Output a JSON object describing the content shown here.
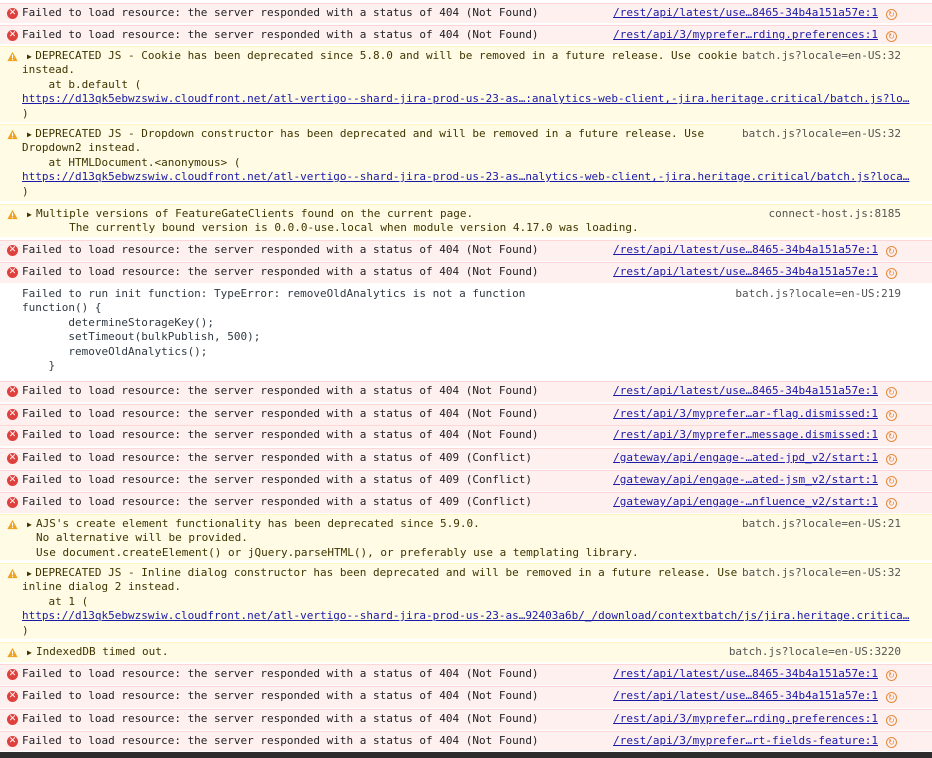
{
  "colors": {
    "error_bg": "#fff0f0",
    "warn_bg": "#fffbe5",
    "error_icon": "#e0403b",
    "warn_icon": "#f0a21c",
    "link": "#1a1aa6"
  },
  "messages": [
    {
      "type": "error",
      "text": "Failed to load resource: the server responded with a status of 404 (Not Found)",
      "source": "/rest/api/latest/use…8465-34b4a151a57e:1"
    },
    {
      "type": "error",
      "text": "Failed to load resource: the server responded with a status of 404 (Not Found)",
      "source": "/rest/api/3/myprefer…rding.preferences:1"
    },
    {
      "type": "warn",
      "text": "DEPRECATED JS - Cookie has been deprecated since 5.8.0 and will be removed in a future release. Use cookie\ninstead.\n    at b.default (",
      "url": "https://d13qk5ebwzswiw.cloudfront.net/atl-vertigo--shard-jira-prod-us-23-as…:analytics-web-client,-jira.heritage.critical/batch.js?lo…",
      "tail": ")",
      "source": "batch.js?locale=en-US:32"
    },
    {
      "type": "warn",
      "text": "DEPRECATED JS - Dropdown constructor has been deprecated and will be removed in a future release. Use\nDropdown2 instead.\n    at HTMLDocument.<anonymous> (",
      "url": "https://d13qk5ebwzswiw.cloudfront.net/atl-vertigo--shard-jira-prod-us-23-as…nalytics-web-client,-jira.heritage.critical/batch.js?loca…",
      "tail": ")",
      "source": "batch.js?locale=en-US:32"
    },
    {
      "type": "warn",
      "text": "Multiple versions of FeatureGateClients found on the current page.\n     The currently bound version is 0.0.0-use.local when module version 4.17.0 was loading.",
      "source": "connect-host.js:8185"
    },
    {
      "type": "error",
      "text": "Failed to load resource: the server responded with a status of 404 (Not Found)",
      "source": "/rest/api/latest/use…8465-34b4a151a57e:1"
    },
    {
      "type": "error",
      "text": "Failed to load resource: the server responded with a status of 404 (Not Found)",
      "source": "/rest/api/latest/use…8465-34b4a151a57e:1"
    },
    {
      "type": "log",
      "text": "Failed to run init function: TypeError: removeOldAnalytics is not a function\nfunction() {\n       determineStorageKey();\n       setTimeout(bulkPublish, 500);\n       removeOldAnalytics();\n    }",
      "source": "batch.js?locale=en-US:219"
    },
    {
      "type": "error",
      "text": "Failed to load resource: the server responded with a status of 404 (Not Found)",
      "source": "/rest/api/latest/use…8465-34b4a151a57e:1"
    },
    {
      "type": "error",
      "text": "Failed to load resource: the server responded with a status of 404 (Not Found)",
      "source": "/rest/api/3/myprefer…ar-flag.dismissed:1"
    },
    {
      "type": "error",
      "text": "Failed to load resource: the server responded with a status of 404 (Not Found)",
      "source": "/rest/api/3/myprefer…message.dismissed:1"
    },
    {
      "type": "error",
      "text": "Failed to load resource: the server responded with a status of 409 (Conflict)",
      "source": "/gateway/api/engage-…ated-jpd_v2/start:1"
    },
    {
      "type": "error",
      "text": "Failed to load resource: the server responded with a status of 409 (Conflict)",
      "source": "/gateway/api/engage-…ated-jsm_v2/start:1"
    },
    {
      "type": "error",
      "text": "Failed to load resource: the server responded with a status of 409 (Conflict)",
      "source": "/gateway/api/engage-…nfluence_v2/start:1"
    },
    {
      "type": "warn",
      "text": "AJS's create element functionality has been deprecated since 5.9.0.\nNo alternative will be provided.\nUse document.createElement() or jQuery.parseHTML(), or preferably use a templating library.",
      "source": "batch.js?locale=en-US:21"
    },
    {
      "type": "warn",
      "text": "DEPRECATED JS - Inline dialog constructor has been deprecated and will be removed in a future release. Use\ninline dialog 2 instead.\n    at 1 (",
      "url": "https://d13qk5ebwzswiw.cloudfront.net/atl-vertigo--shard-jira-prod-us-23-as…92403a6b/_/download/contextbatch/js/jira.heritage.critica…",
      "tail": ")",
      "source": "batch.js?locale=en-US:32"
    },
    {
      "type": "warn",
      "text": "IndexedDB timed out.",
      "source": "batch.js?locale=en-US:3220"
    },
    {
      "type": "error",
      "text": "Failed to load resource: the server responded with a status of 404 (Not Found)",
      "source": "/rest/api/latest/use…8465-34b4a151a57e:1"
    },
    {
      "type": "error",
      "text": "Failed to load resource: the server responded with a status of 404 (Not Found)",
      "source": "/rest/api/latest/use…8465-34b4a151a57e:1"
    },
    {
      "type": "error",
      "text": "Failed to load resource: the server responded with a status of 404 (Not Found)",
      "source": "/rest/api/3/myprefer…rding.preferences:1"
    },
    {
      "type": "error",
      "text": "Failed to load resource: the server responded with a status of 404 (Not Found)",
      "source": "/rest/api/3/myprefer…rt-fields-feature:1"
    }
  ]
}
